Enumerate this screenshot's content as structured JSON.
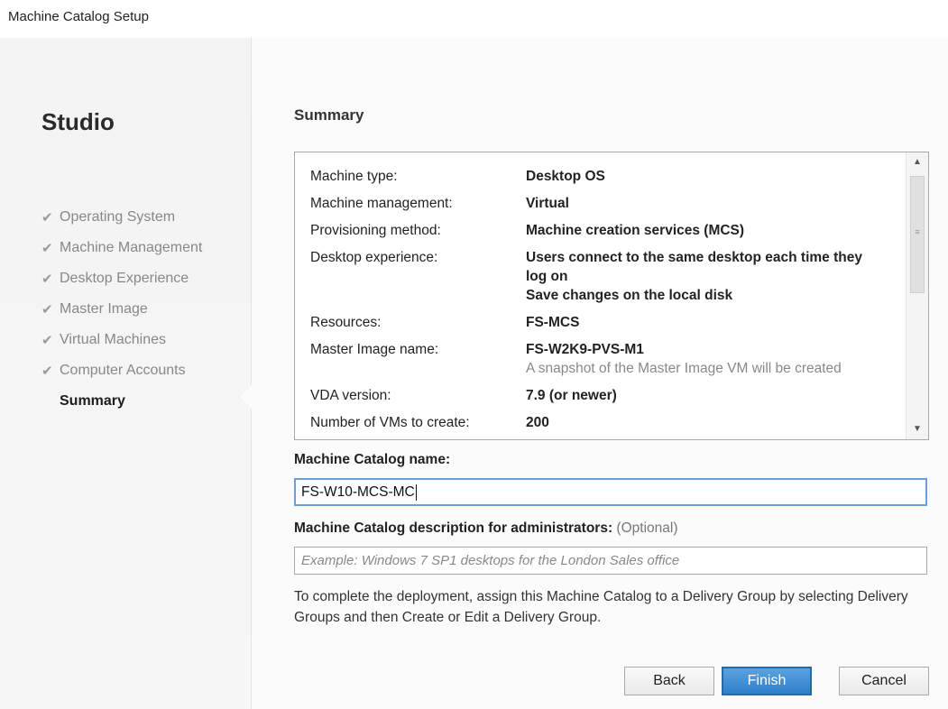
{
  "window": {
    "title": "Machine Catalog Setup"
  },
  "sidebar": {
    "brand": "Studio",
    "steps": [
      {
        "label": "Operating System",
        "done": true
      },
      {
        "label": "Machine Management",
        "done": true
      },
      {
        "label": "Desktop Experience",
        "done": true
      },
      {
        "label": "Master Image",
        "done": true
      },
      {
        "label": "Virtual Machines",
        "done": true
      },
      {
        "label": "Computer Accounts",
        "done": true
      },
      {
        "label": "Summary",
        "done": false,
        "active": true
      }
    ]
  },
  "main": {
    "section_title": "Summary",
    "summary": [
      {
        "key": "Machine type:",
        "value": "Desktop OS"
      },
      {
        "key": "Machine management:",
        "value": "Virtual"
      },
      {
        "key": "Provisioning method:",
        "value": "Machine creation services (MCS)"
      },
      {
        "key": "Desktop experience:",
        "value": "Users connect to the same desktop each time they log on",
        "value2": "Save changes on the local disk"
      },
      {
        "key": "Resources:",
        "value": "FS-MCS"
      },
      {
        "key": "Master Image name:",
        "value": "FS-W2K9-PVS-M1",
        "note": "A snapshot of the Master Image VM will be created"
      },
      {
        "key": "VDA version:",
        "value": "7.9 (or newer)"
      },
      {
        "key": "Number of VMs to create:",
        "value": "200"
      }
    ],
    "catalog_name_label": "Machine Catalog name:",
    "catalog_name_value": "FS-W10-MCS-MC",
    "description_label": "Machine Catalog description for administrators:",
    "description_optional": "(Optional)",
    "description_placeholder": "Example: Windows 7 SP1 desktops for the London Sales office",
    "help_text": "To complete the deployment, assign this Machine Catalog to a Delivery Group by selecting Delivery Groups and then Create or Edit a Delivery Group."
  },
  "buttons": {
    "back": "Back",
    "finish": "Finish",
    "cancel": "Cancel"
  },
  "icons": {
    "step_done": "checkmark-icon",
    "scroll_up": "arrow-up-icon",
    "scroll_down": "arrow-down-icon"
  }
}
